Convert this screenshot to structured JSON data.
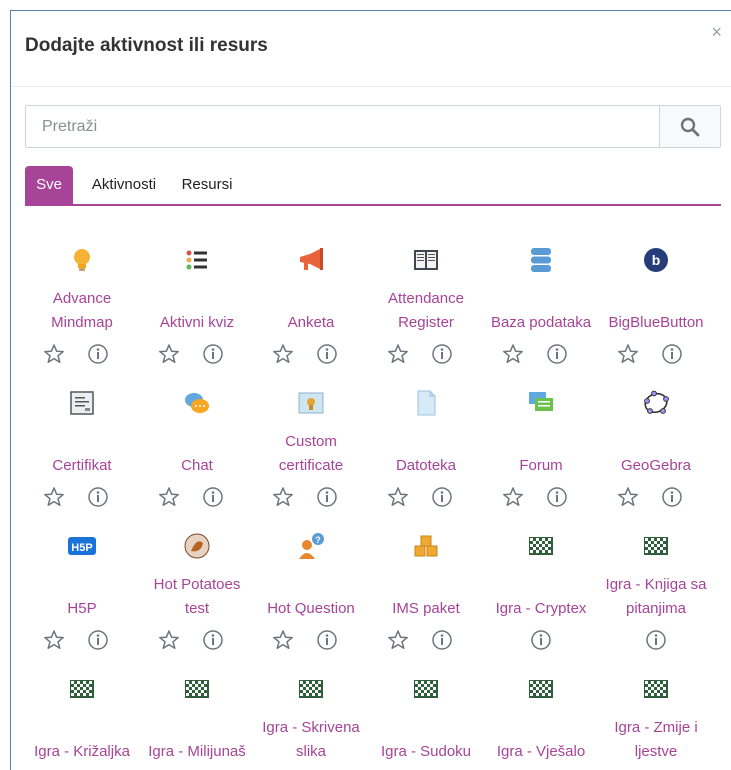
{
  "dialog": {
    "title": "Dodajte aktivnost ili resurs",
    "close_glyph": "×"
  },
  "search": {
    "placeholder": "Pretraži",
    "value": ""
  },
  "tabs": [
    {
      "label": "Sve",
      "active": true
    },
    {
      "label": "Aktivnosti",
      "active": false
    },
    {
      "label": "Resursi",
      "active": false
    }
  ],
  "items": [
    {
      "label": "Advance Mindmap",
      "icon": "lightbulb-icon",
      "star": true
    },
    {
      "label": "Aktivni kviz",
      "icon": "list-icon",
      "star": true
    },
    {
      "label": "Anketa",
      "icon": "megaphone-icon",
      "star": true
    },
    {
      "label": "Attendance Register",
      "icon": "book-icon",
      "star": true
    },
    {
      "label": "Baza podataka",
      "icon": "database-icon",
      "star": true
    },
    {
      "label": "BigBlueButton",
      "icon": "bigbluebutton-icon",
      "star": true
    },
    {
      "label": "Certifikat",
      "icon": "certificate-icon",
      "star": true
    },
    {
      "label": "Chat",
      "icon": "chat-icon",
      "star": true
    },
    {
      "label": "Custom certificate",
      "icon": "award-icon",
      "star": true
    },
    {
      "label": "Datoteka",
      "icon": "file-icon",
      "star": true
    },
    {
      "label": "Forum",
      "icon": "forum-icon",
      "star": true
    },
    {
      "label": "GeoGebra",
      "icon": "geogebra-icon",
      "star": true
    },
    {
      "label": "H5P",
      "icon": "h5p-icon",
      "star": true
    },
    {
      "label": "Hot Potatoes test",
      "icon": "hotpot-icon",
      "star": true
    },
    {
      "label": "Hot Question",
      "icon": "hotquestion-icon",
      "star": true
    },
    {
      "label": "IMS paket",
      "icon": "ims-icon",
      "star": true
    },
    {
      "label": "Igra - Cryptex",
      "icon": "game-icon",
      "star": false
    },
    {
      "label": "Igra - Knjiga sa pitanjima",
      "icon": "game-icon",
      "star": false
    },
    {
      "label": "Igra - Križaljka",
      "icon": "game-icon",
      "star": false
    },
    {
      "label": "Igra - Milijunaš",
      "icon": "game-icon",
      "star": false
    },
    {
      "label": "Igra - Skrivena slika",
      "icon": "game-icon",
      "star": false
    },
    {
      "label": "Igra - Sudoku",
      "icon": "game-icon",
      "star": false
    },
    {
      "label": "Igra - Vješalo",
      "icon": "game-icon",
      "star": false
    },
    {
      "label": "Igra - Zmije i ljestve",
      "icon": "game-icon",
      "star": false
    }
  ],
  "colors": {
    "accent": "#a74498",
    "icon_gray": "#6c757d"
  }
}
